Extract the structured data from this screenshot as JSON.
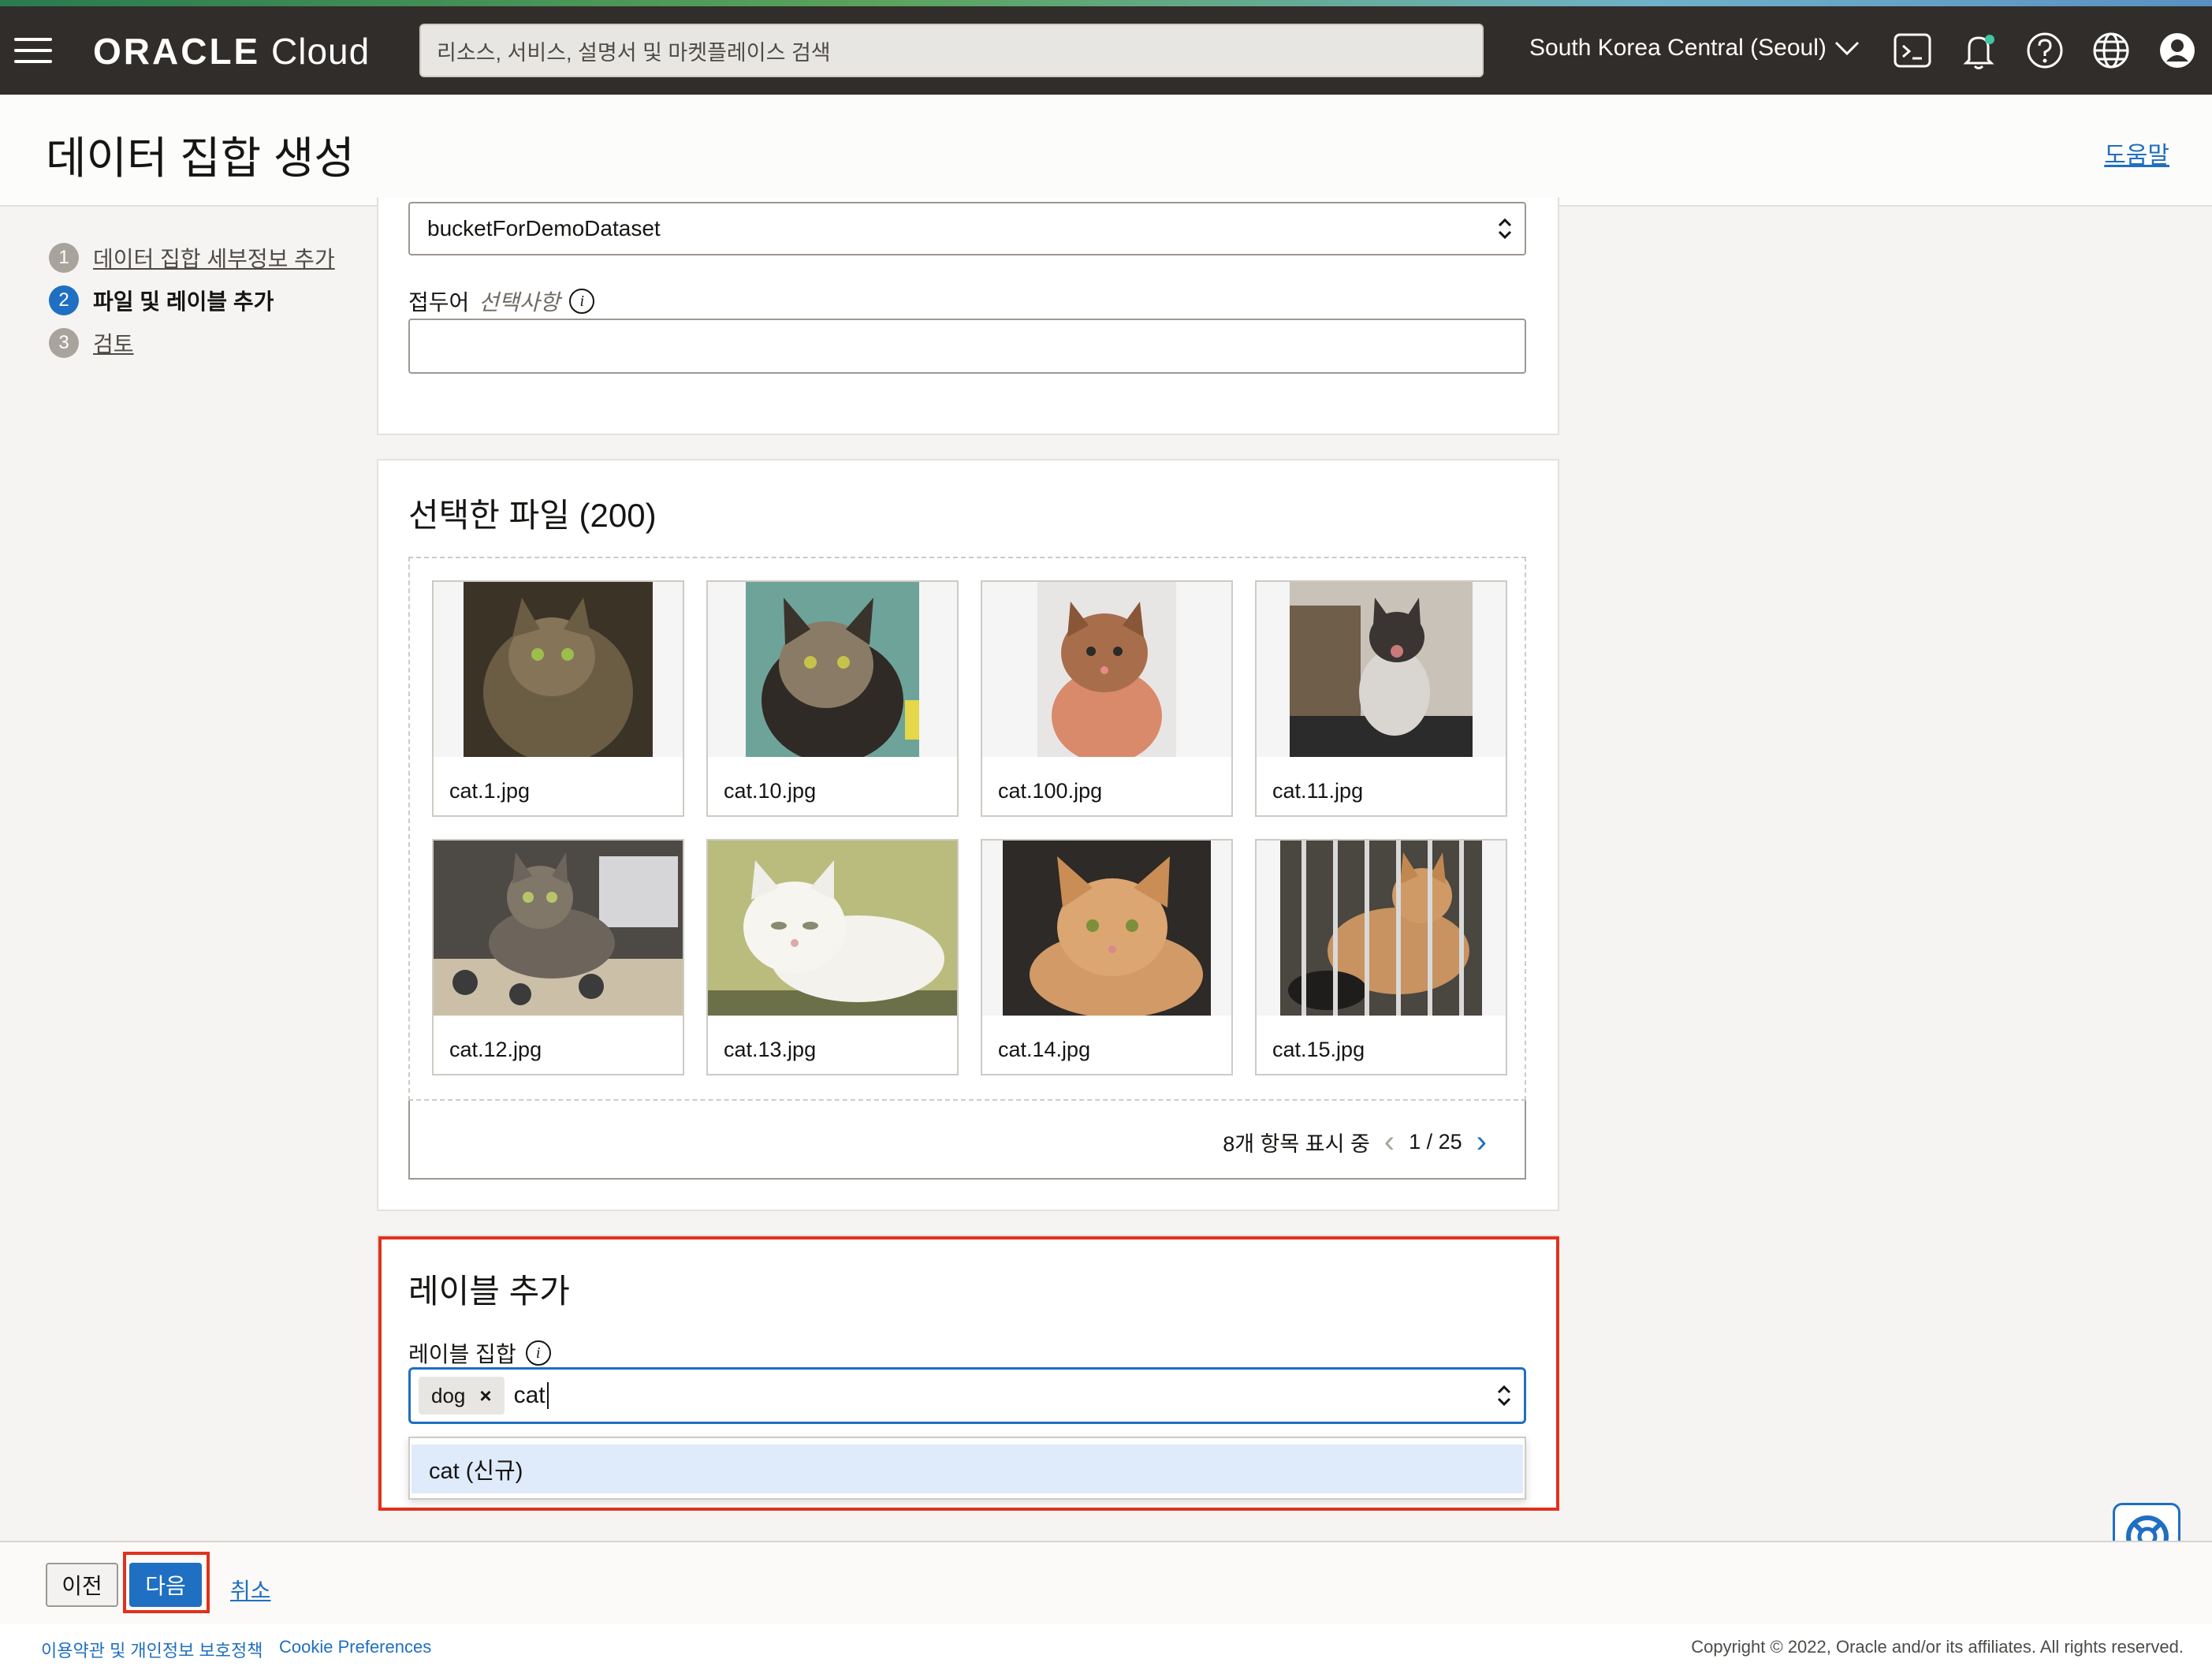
{
  "header": {
    "logo_brand": "ORACLE",
    "logo_product": "Cloud",
    "search_placeholder": "리소스, 서비스, 설명서 및 마켓플레이스 검색",
    "region": "South Korea Central (Seoul)",
    "icons": [
      "menu-icon",
      "cloud-shell-icon",
      "bell-icon",
      "help-icon",
      "globe-icon",
      "profile-icon"
    ]
  },
  "page": {
    "title": "데이터 집합 생성",
    "help_link": "도움말"
  },
  "steps": [
    {
      "num": "1",
      "label": "데이터 집합 세부정보 추가"
    },
    {
      "num": "2",
      "label": "파일 및 레이블 추가"
    },
    {
      "num": "3",
      "label": "검토"
    }
  ],
  "bucket": {
    "selected": "bucketForDemoDataset",
    "prefix_label": "접두어",
    "prefix_optional": "선택사항",
    "prefix_value": ""
  },
  "files": {
    "title": "선택한 파일 (200)",
    "items": [
      "cat.1.jpg",
      "cat.10.jpg",
      "cat.100.jpg",
      "cat.11.jpg",
      "cat.12.jpg",
      "cat.13.jpg",
      "cat.14.jpg",
      "cat.15.jpg"
    ],
    "pager_text": "8개 항목 표시 중",
    "page": "1 / 25"
  },
  "labels": {
    "title": "레이블 추가",
    "field_label": "레이블 집합",
    "chips": [
      "dog"
    ],
    "typed": "cat",
    "suggestion": "cat (신규)"
  },
  "actions": {
    "prev": "이전",
    "next": "다음",
    "cancel": "취소"
  },
  "footer": {
    "terms": "이용약관 및 개인정보 보호정책",
    "cookies": "Cookie Preferences",
    "copyright": "Copyright © 2022, Oracle and/or its affiliates. All rights reserved."
  },
  "colors": {
    "accent": "#1f6fc2",
    "header_bg": "#312d2a",
    "highlight_red": "#e0321c"
  }
}
